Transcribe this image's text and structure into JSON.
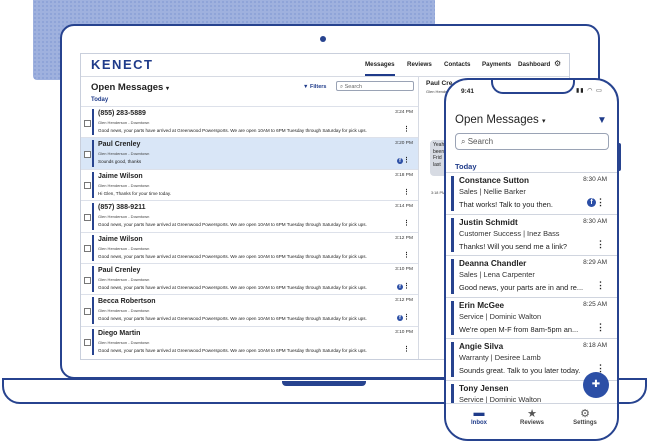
{
  "app": {
    "logo": "KENECT"
  },
  "nav": [
    "Messages",
    "Reviews",
    "Contacts",
    "Payments",
    "Dashboard"
  ],
  "nav_active": "Messages",
  "desktop": {
    "title": "Open Messages",
    "filters_label": "Filters",
    "search_placeholder": "Search",
    "section": "Today",
    "conversations": [
      {
        "name": "(855) 283-5889",
        "sub": "Glen Henderson - Downtown",
        "time": "3:24 PM",
        "msg": "Good news, your parts have arrived at Greenwood Powersports. We are open 10AM to 6PM Tuesday through Saturday for pick ups.",
        "fb": false,
        "selected": false
      },
      {
        "name": "Paul Crenley",
        "sub": "Glen Henderson - Downtown",
        "time": "3:20 PM",
        "msg": "Sounds good, thanks",
        "fb": true,
        "selected": true
      },
      {
        "name": "Jaime Wilson",
        "sub": "Glen Henderson - Downtown",
        "time": "3:18 PM",
        "msg": "Hi Glen, Thanks for your time today.",
        "fb": false,
        "selected": false
      },
      {
        "name": "(857) 388-9211",
        "sub": "Glen Henderson - Downtown",
        "time": "3:14 PM",
        "msg": "Good news, your parts have arrived at Greenwood Powersports. We are open 10AM to 6PM Tuesday through Saturday for pick ups.",
        "fb": false,
        "selected": false
      },
      {
        "name": "Jaime Wilson",
        "sub": "Glen Henderson - Downtown",
        "time": "3:12 PM",
        "msg": "Good news, your parts have arrived at Greenwood Powersports. We are open 10AM to 6PM Tuesday through Saturday for pick ups.",
        "fb": false,
        "selected": false
      },
      {
        "name": "Paul Crenley",
        "sub": "Glen Henderson - Downtown",
        "time": "3:10 PM",
        "msg": "Good news, your parts have arrived at Greenwood Powersports. We are open 10AM to 6PM Tuesday through Saturday for pick ups.",
        "fb": true,
        "selected": false
      },
      {
        "name": "Becca Robertson",
        "sub": "Glen Henderson - Downtown",
        "time": "3:12 PM",
        "msg": "Good news, your parts have arrived at Greenwood Powersports. We are open 10AM to 6PM Tuesday through Saturday for pick ups.",
        "fb": true,
        "selected": false
      },
      {
        "name": "Diego Martin",
        "sub": "Glen Henderson - Downtown",
        "time": "3:10 PM",
        "msg": "Good news, your parts have arrived at Greenwood Powersports. We are open 10AM to 6PM Tuesday through Saturday for pick ups.",
        "fb": false,
        "selected": false
      }
    ],
    "detail": {
      "name": "Paul Cre",
      "sub": "Glen Hende",
      "bubble": "Yeah\nbeen\nFrid\nlast",
      "time": "3:18 PM"
    }
  },
  "phone": {
    "time": "9:41",
    "status": "▮▮ ◠ ▭",
    "title": "Open Messages",
    "search_placeholder": "Search",
    "section": "Today",
    "conversations": [
      {
        "name": "Constance Sutton",
        "sub": "Sales | Nellie Barker",
        "time": "8:30 AM",
        "msg": "That works! Talk to you then.",
        "fb": true
      },
      {
        "name": "Justin Schmidt",
        "sub": "Customer Success | Inez Bass",
        "time": "8:30 AM",
        "msg": "Thanks! Will you send me a link?",
        "fb": false
      },
      {
        "name": "Deanna Chandler",
        "sub": "Sales | Lena Carpenter",
        "time": "8:29 AM",
        "msg": "Good news, your parts are in and re...",
        "fb": false
      },
      {
        "name": "Erin McGee",
        "sub": "Service | Dominic Walton",
        "time": "8:25 AM",
        "msg": "We're open M-F from 8am-5pm an...",
        "fb": false
      },
      {
        "name": "Angie Silva",
        "sub": "Warranty | Desiree Lamb",
        "time": "8:18 AM",
        "msg": "Sounds great. Talk to you later today.",
        "fb": false
      },
      {
        "name": "Tony Jensen",
        "sub": "Service | Dominic Walton",
        "time": "",
        "msg": "",
        "fb": false
      }
    ],
    "tabs": [
      {
        "label": "Inbox",
        "icon": "inbox-icon"
      },
      {
        "label": "Reviews",
        "icon": "star-icon"
      },
      {
        "label": "Settings",
        "icon": "gear-icon"
      }
    ]
  },
  "colors": {
    "brand": "#27438f",
    "selected_row": "#d9e6f7",
    "backdrop": "#9fb1de"
  }
}
